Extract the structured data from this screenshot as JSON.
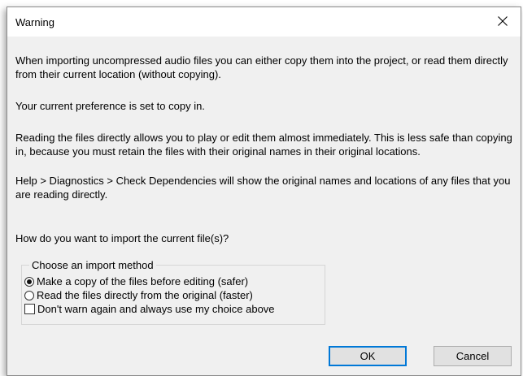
{
  "window": {
    "title": "Warning",
    "close_glyph": "close-icon"
  },
  "message": {
    "paragraph1": "When importing uncompressed audio files you can either copy them into the project, or read them directly from their current location (without copying).",
    "paragraph2": "Your current preference is set to copy in.",
    "paragraph3": "Reading the files directly allows you to play or edit them almost immediately.  This is less safe than copying in, because you must retain the files with their original names in their original locations.",
    "paragraph4": "Help > Diagnostics > Check Dependencies will show the original names and locations of any files that you are reading directly.",
    "question": "How do you want to import the current file(s)?"
  },
  "import_method": {
    "group_label": "Choose an import method",
    "options": [
      {
        "label": "Make a copy of the files before editing (safer)",
        "selected": true
      },
      {
        "label": "Read the files directly from the original (faster)",
        "selected": false
      }
    ],
    "dont_warn_label": "Don't warn again and always use my choice above",
    "dont_warn_checked": false
  },
  "buttons": {
    "ok": "OK",
    "cancel": "Cancel"
  },
  "colors": {
    "dialog_bg": "#f0f0f0",
    "titlebar_bg": "#ffffff",
    "default_button_border": "#0078d7"
  }
}
